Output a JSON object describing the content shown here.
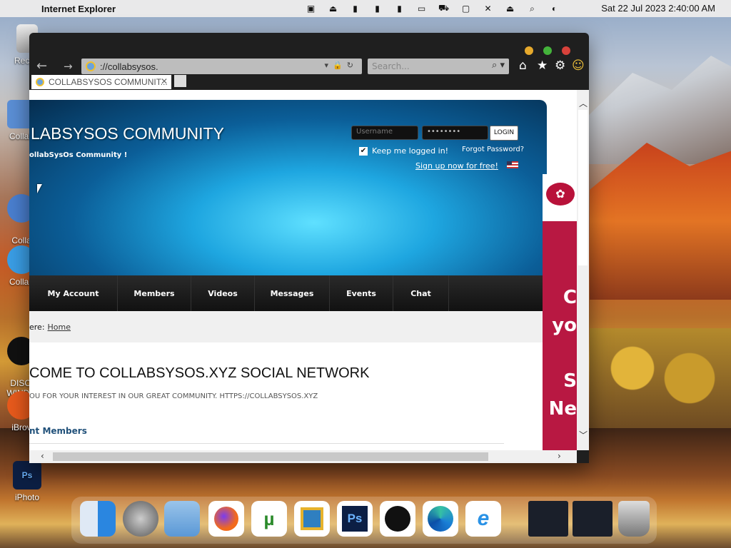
{
  "menubar": {
    "app": "Internet Explorer",
    "clock": "Sat 22 Jul 2023  2:40:00 AM",
    "status_icons": [
      "monitor-icon",
      "eject-circle-icon",
      "memory-meter-icon",
      "ssd-meter-icon",
      "cpu-meter-icon",
      "battery-icon",
      "car-icon",
      "display-icon",
      "mute-icon",
      "eject-icon",
      "search-icon",
      "control-center-icon"
    ]
  },
  "desktop": {
    "icons": [
      "Recycl",
      "Collab",
      "Collab\nCon",
      "Collab",
      "DISCO\nWINDO",
      "iBrov",
      "iPhoto"
    ]
  },
  "browser": {
    "address": "http://collabsysos.xyz/",
    "address_visible": "://collabsysos.",
    "search_placeholder": "Search...",
    "tab_title": "COLLABSYSOS COMMUNIT..."
  },
  "site": {
    "title": "LABSYSOS COMMUNITY",
    "subtitle": "ollabSysOs Community !",
    "username_placeholder": "Username",
    "password_mask": "••••••••",
    "login_label": "LOGIN",
    "keep_logged": "Keep me logged in!",
    "forgot": "Forgot Password?",
    "signup": "Sign up now for free!",
    "nav": [
      "My Account",
      "Members",
      "Videos",
      "Messages",
      "Events",
      "Chat"
    ],
    "breadcrumb_prefix": "ere:",
    "breadcrumb_link": "Home",
    "welcome": "COME TO COLLABSYSOS.XYZ SOCIAL NETWORK",
    "thanks": "OU FOR YOUR INTEREST IN OUR GREAT COMMUNITY. HTTPS://COLLABSYSOS.XYZ",
    "members_heading": "nt Members"
  },
  "ad": {
    "text": [
      "C",
      "yo",
      "",
      "S",
      "Ne"
    ]
  },
  "dock": {
    "apps": [
      "Finder",
      "Launchpad",
      "Folder",
      "Firefox",
      "uTorrent",
      "Archive",
      "Ps",
      "Apple",
      "Edge",
      "IE"
    ]
  },
  "colors": {
    "accent_blue": "#1ea6e0",
    "ad_red": "#b81842",
    "nav_dark": "#1a1a1a"
  }
}
